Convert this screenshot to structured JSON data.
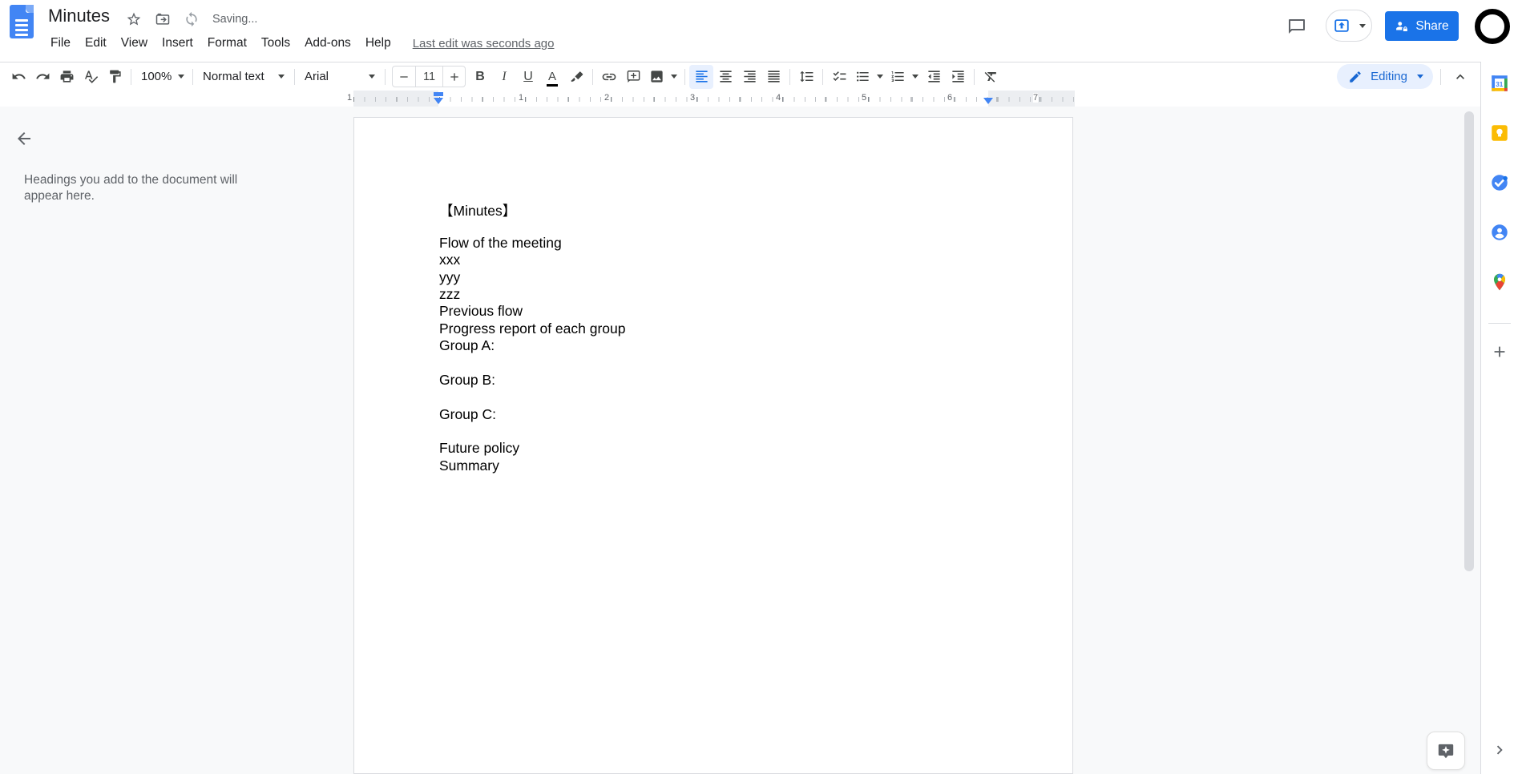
{
  "colors": {
    "accent_blue": "#1a73e8",
    "pill_bg": "#e8f0fe",
    "editing_text": "#1967d2",
    "icon_gray": "#444746",
    "muted_gray": "#5f6368",
    "canvas_bg": "#f8f9fa",
    "border": "#dadce0"
  },
  "header": {
    "title": "Minutes",
    "saving_status": "Saving...",
    "menus": [
      "File",
      "Edit",
      "View",
      "Insert",
      "Format",
      "Tools",
      "Add-ons",
      "Help"
    ],
    "last_edit": "Last edit was seconds ago",
    "share_label": "Share"
  },
  "toolbar": {
    "zoom_value": "100%",
    "style_value": "Normal text",
    "font_value": "Arial",
    "font_size": "11",
    "glyphs": {
      "bold": "B",
      "italic": "I",
      "underline": "U",
      "text_color": "A"
    },
    "mode_label": "Editing"
  },
  "outline_panel": {
    "placeholder": "Headings you add to the document will appear here."
  },
  "ruler": {
    "all_numbers": [
      "1",
      "1",
      "2",
      "3",
      "4",
      "5",
      "6",
      "7"
    ]
  },
  "document": {
    "lines": [
      "【Minutes】",
      "",
      "Flow of the meeting",
      "xxx",
      "yyy",
      "zzz",
      "Previous flow",
      "Progress report of each group",
      "Group A:",
      "",
      "Group B:",
      "",
      "Group C:",
      "",
      "Future policy",
      "Summary"
    ]
  },
  "side_rail": {
    "icons": [
      "google-calendar",
      "google-keep",
      "google-tasks",
      "google-contacts",
      "google-maps"
    ],
    "plus_glyph": "+",
    "calendar_day": "31"
  }
}
